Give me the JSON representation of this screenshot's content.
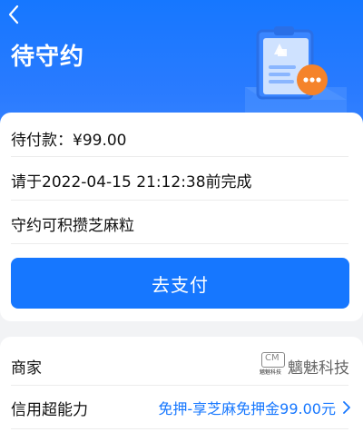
{
  "header": {
    "title": "待守约",
    "colors": {
      "primary": "#1677ff",
      "header_bg": "#2a7bff",
      "accent_orange": "#f5832a"
    }
  },
  "order": {
    "pending_amount": "待付款：¥99.00",
    "deadline_text": "请于2022-04-15 21:12:38前完成",
    "points_text": "守约可积攒芝麻粒",
    "pay_button_label": "去支付"
  },
  "merchant": {
    "label": "商家",
    "name": "魑魅科技",
    "logo_mark_text": "CM",
    "logo_caption": "魑魅科技"
  },
  "credit": {
    "label": "信用超能力",
    "link_text": "免押-享芝麻免押金99.00元"
  },
  "icons": {
    "back": "back-chevron-icon",
    "illustration": "clipboard-document-icon",
    "more": "more-dots-icon",
    "chevron": "chevron-right-icon"
  }
}
